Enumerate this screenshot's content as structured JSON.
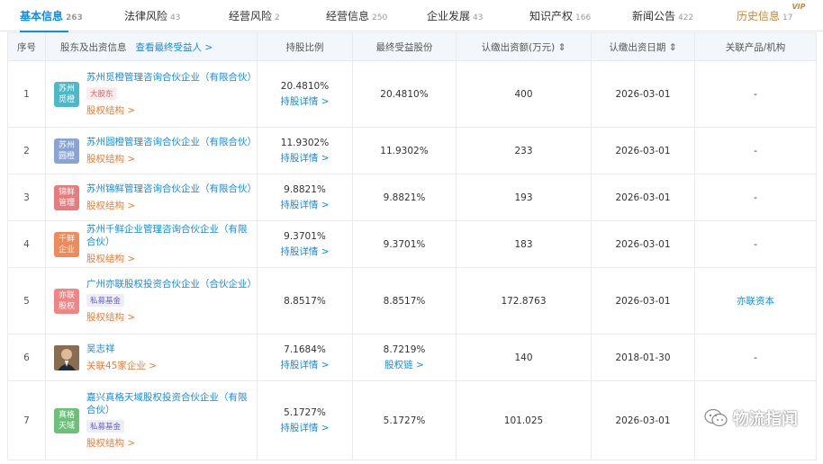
{
  "tabs": [
    {
      "label": "基本信息",
      "count": "263",
      "active": true
    },
    {
      "label": "法律风险",
      "count": "43"
    },
    {
      "label": "经营风险",
      "count": "2"
    },
    {
      "label": "经营信息",
      "count": "250"
    },
    {
      "label": "企业发展",
      "count": "43"
    },
    {
      "label": "知识产权",
      "count": "166"
    },
    {
      "label": "新闻公告",
      "count": "422"
    },
    {
      "label": "历史信息",
      "count": "17",
      "vip": "VIP"
    }
  ],
  "table": {
    "headers": {
      "seq": "序号",
      "holder": "股东及出资信息",
      "holder_link": "查看最终受益人 >",
      "ratio": "持股比例",
      "final": "最终受益股份",
      "amount": "认缴出资额(万元) ⇕",
      "date": "认缴出资日期 ⇕",
      "related": "关联产品/机构"
    },
    "rows": [
      {
        "seq": "1",
        "logo": "苏州觅橙",
        "logo_color": "#4db8c8",
        "name": "苏州觅橙管理咨询合伙企业（有限合伙）",
        "tag": "大股东",
        "tag_type": "big",
        "sub": "股权结构 >",
        "ratio": "20.4810%",
        "ratio_link": "持股详情 >",
        "final": "20.4810%",
        "final_link": "",
        "amount": "400",
        "date": "2026-03-01",
        "related": "-"
      },
      {
        "seq": "2",
        "logo": "苏州圆橙",
        "logo_color": "#8aa3d6",
        "name": "苏州圆橙管理咨询合伙企业（有限合伙）",
        "tag": "",
        "tag_type": "",
        "sub": "股权结构 >",
        "ratio": "11.9302%",
        "ratio_link": "持股详情 >",
        "final": "11.9302%",
        "final_link": "",
        "amount": "233",
        "date": "2026-03-01",
        "related": "-"
      },
      {
        "seq": "3",
        "logo": "锦鲜管理",
        "logo_color": "#e87c7c",
        "name": "苏州锦鲜管理咨询合伙企业（有限合伙）",
        "tag": "",
        "tag_type": "",
        "sub": "股权结构 >",
        "ratio": "9.8821%",
        "ratio_link": "持股详情 >",
        "final": "9.8821%",
        "final_link": "",
        "amount": "193",
        "date": "2026-03-01",
        "related": "-"
      },
      {
        "seq": "4",
        "logo": "千鲜企业",
        "logo_color": "#ef8a5c",
        "name": "苏州千鲜企业管理咨询合伙企业（有限合伙）",
        "tag": "",
        "tag_type": "",
        "sub": "股权结构 >",
        "ratio": "9.3701%",
        "ratio_link": "持股详情 >",
        "final": "9.3701%",
        "final_link": "",
        "amount": "183",
        "date": "2026-03-01",
        "related": "-"
      },
      {
        "seq": "5",
        "logo": "亦联股权",
        "logo_color": "#ef8585",
        "name": "广州亦联股权投资合伙企业（合伙企业）",
        "tag": "私募基金",
        "tag_type": "fund",
        "sub": "股权结构 >",
        "ratio": "8.8517%",
        "ratio_link": "",
        "final": "8.8517%",
        "final_link": "",
        "amount": "172.8763",
        "date": "2026-03-01",
        "related": "亦联资本"
      },
      {
        "seq": "6",
        "logo": "",
        "logo_color": "",
        "photo": true,
        "name": "吴志祥",
        "tag": "",
        "tag_type": "",
        "sub": "关联45家企业 >",
        "ratio": "7.1684%",
        "ratio_link": "持股详情 >",
        "final": "8.7219%",
        "final_link": "股权链 >",
        "amount": "140",
        "date": "2018-01-30",
        "related": "-"
      },
      {
        "seq": "7",
        "logo": "真格天域",
        "logo_color": "#6cc07a",
        "name": "嘉兴真格天域股权投资合伙企业（有限合伙）",
        "tag": "私募基金",
        "tag_type": "fund",
        "sub": "股权结构 >",
        "ratio": "5.1727%",
        "ratio_link": "持股详情 >",
        "final": "5.1727%",
        "final_link": "",
        "amount": "101.025",
        "date": "2026-03-01",
        "related": "-"
      }
    ]
  },
  "watermark": {
    "text": "物流指闻",
    "icon": "wechat-icon"
  }
}
